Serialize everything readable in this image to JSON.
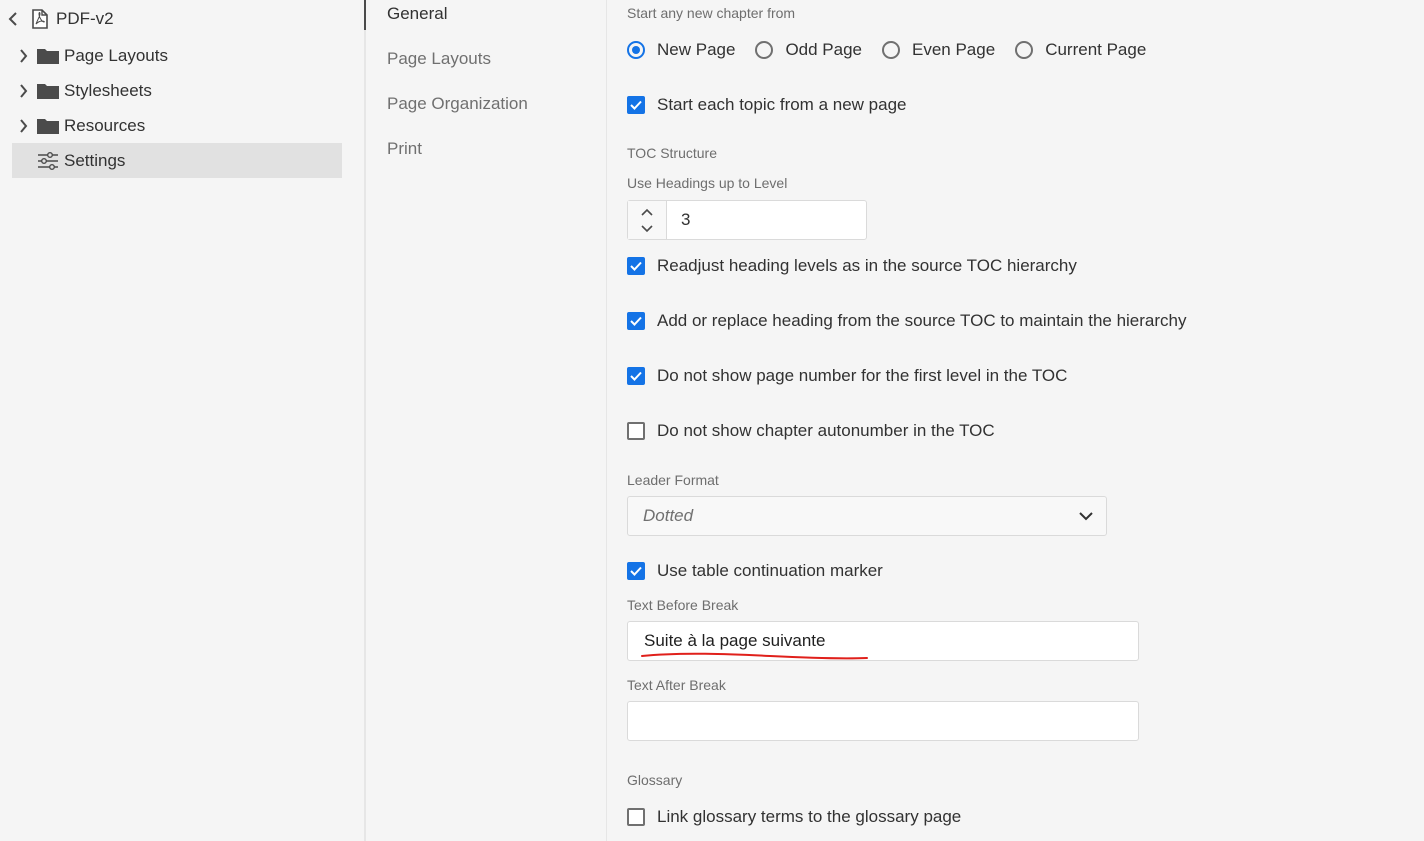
{
  "tree": {
    "title": "PDF-v2",
    "items": [
      {
        "label": "Page Layouts",
        "icon": "folder-icon"
      },
      {
        "label": "Stylesheets",
        "icon": "folder-icon"
      },
      {
        "label": "Resources",
        "icon": "folder-icon"
      },
      {
        "label": "Settings",
        "icon": "settings-sliders-icon",
        "selected": true
      }
    ]
  },
  "tabs": [
    {
      "label": "General",
      "active": true
    },
    {
      "label": "Page Layouts"
    },
    {
      "label": "Page Organization"
    },
    {
      "label": "Print"
    }
  ],
  "general": {
    "chapter_start": {
      "label": "Start any new chapter from",
      "options": [
        "New Page",
        "Odd Page",
        "Even Page",
        "Current Page"
      ],
      "selected": "New Page"
    },
    "start_topic_new_page": {
      "label": "Start each topic from a new page",
      "checked": true
    },
    "toc_structure": {
      "label": "TOC Structure",
      "levels_label": "Use Headings up to Level",
      "levels_value": "3",
      "readjust": {
        "label": "Readjust heading levels as in the source TOC hierarchy",
        "checked": true
      },
      "add_replace": {
        "label": "Add or replace heading from the source TOC to maintain the hierarchy",
        "checked": true
      },
      "no_page_number": {
        "label": "Do not show page number for the first level in the TOC",
        "checked": true
      },
      "no_autonumber": {
        "label": "Do not show chapter autonumber in the TOC",
        "checked": false
      }
    },
    "leader_format": {
      "label": "Leader Format",
      "value": "Dotted"
    },
    "table_continuation": {
      "label": "Use table continuation marker",
      "checked": true
    },
    "text_before_break": {
      "label": "Text Before Break",
      "value": "Suite à la page suivante"
    },
    "text_after_break": {
      "label": "Text After Break",
      "value": ""
    },
    "glossary": {
      "label": "Glossary",
      "link_terms": {
        "label": "Link glossary terms to the glossary page",
        "checked": false
      }
    }
  },
  "colors": {
    "accent": "#1473e6",
    "annotation": "#e0201b"
  }
}
